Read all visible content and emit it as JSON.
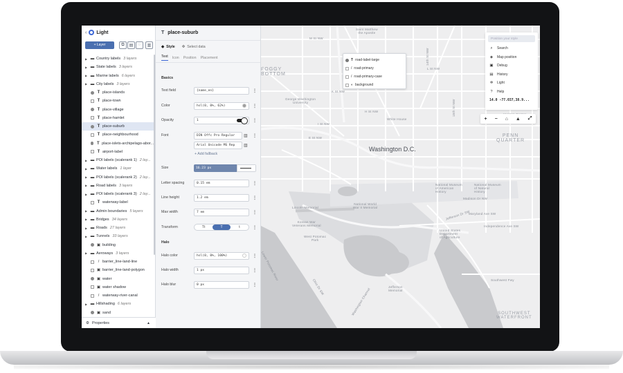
{
  "app": {
    "back_glyph": "‹",
    "title": "Light"
  },
  "toolbar": {
    "add_layer_label": "+ Layer",
    "buttons": [
      "copy-icon",
      "layers-icon",
      "visibility-icon",
      "trash-icon"
    ]
  },
  "layers": [
    {
      "type": "group",
      "name": "Country labels",
      "count": "3 layers"
    },
    {
      "type": "group",
      "name": "State labels",
      "count": "3 layers"
    },
    {
      "type": "group",
      "name": "Marine labels",
      "count": "6 layers"
    },
    {
      "type": "group",
      "name": "City labels",
      "count": "3 layers"
    },
    {
      "type": "symbol",
      "name": "place-islands",
      "count": ""
    },
    {
      "type": "symbol",
      "name": "place-town",
      "count": ""
    },
    {
      "type": "symbol",
      "name": "place-village",
      "count": ""
    },
    {
      "type": "symbol",
      "name": "place-hamlet",
      "count": ""
    },
    {
      "type": "symbol",
      "name": "place-suburb",
      "count": "",
      "selected": true
    },
    {
      "type": "symbol",
      "name": "place-neighbourhood",
      "count": ""
    },
    {
      "type": "symbol",
      "name": "place-islets-archipelago-abor...",
      "count": ""
    },
    {
      "type": "symbol",
      "name": "airport-label",
      "count": ""
    },
    {
      "type": "group",
      "name": "POI labels (scalerank 1)",
      "count": "2 lay..."
    },
    {
      "type": "group",
      "name": "Water labels",
      "count": "1 layer"
    },
    {
      "type": "group",
      "name": "POI labels (scalerank 2)",
      "count": "2 lay..."
    },
    {
      "type": "group",
      "name": "Road labels",
      "count": "3 layers"
    },
    {
      "type": "group",
      "name": "POI labels (scalerank 3)",
      "count": "2 lay..."
    },
    {
      "type": "symbol",
      "name": "waterway-label",
      "count": ""
    },
    {
      "type": "group",
      "name": "Admin boundaries",
      "count": "5 layers"
    },
    {
      "type": "group",
      "name": "Bridges",
      "count": "34 layers"
    },
    {
      "type": "group",
      "name": "Roads",
      "count": "27 layers"
    },
    {
      "type": "group",
      "name": "Tunnels",
      "count": "33 layers"
    },
    {
      "type": "fill",
      "name": "building",
      "count": ""
    },
    {
      "type": "group",
      "name": "Aeroways",
      "count": "3 layers"
    },
    {
      "type": "line",
      "name": "barrier_line-land-line",
      "count": ""
    },
    {
      "type": "fill",
      "name": "barrier_line-land-polygon",
      "count": ""
    },
    {
      "type": "fill",
      "name": "water",
      "count": ""
    },
    {
      "type": "fill",
      "name": "water shadow",
      "count": ""
    },
    {
      "type": "line",
      "name": "waterway-river-canal",
      "count": ""
    },
    {
      "type": "group",
      "name": "Hillshading",
      "count": "6 layers"
    },
    {
      "type": "fill",
      "name": "sand",
      "count": ""
    }
  ],
  "bottom": {
    "label": "Properties",
    "caret": "▲"
  },
  "editor": {
    "layer_icon": "T",
    "layer_name": "place-suburb",
    "tabs": [
      "Style",
      "Select data"
    ],
    "subtabs": [
      "Text",
      "Icon",
      "Position",
      "Placement"
    ],
    "sections": {
      "basics": "Basics",
      "halo": "Halo"
    },
    "fields": {
      "text_field": {
        "label": "Text field",
        "value": "{name_en}"
      },
      "color": {
        "label": "Color",
        "value": "hsl(0, 0%, 62%)"
      },
      "opacity": {
        "label": "Opacity",
        "value": "1"
      },
      "font": {
        "label": "Font",
        "values": [
          "DIN Offc Pro Regular",
          "Arial Unicode MS Rep"
        ],
        "add": "+ Add fallback"
      },
      "size": {
        "label": "Size",
        "value": "16.23 px"
      },
      "letter_spacing": {
        "label": "Letter spacing",
        "value": "0.15 em"
      },
      "line_height": {
        "label": "Line height",
        "value": "1.2 em"
      },
      "max_width": {
        "label": "Max width",
        "value": "7 em"
      },
      "transform": {
        "label": "Transform",
        "options": [
          "Tt",
          "T",
          "t"
        ],
        "selected": 1
      },
      "halo_color": {
        "label": "Halo color",
        "value": "hsl(0, 0%, 100%)"
      },
      "halo_width": {
        "label": "Halo width",
        "value": "1 px"
      },
      "halo_blur": {
        "label": "Halo blur",
        "value": "0 px"
      }
    }
  },
  "map": {
    "popup": [
      {
        "icon": "T",
        "name": "road-label-large"
      },
      {
        "icon": "/",
        "name": "road-primary"
      },
      {
        "icon": "/",
        "name": "road-primary-case"
      },
      {
        "icon": "◐",
        "name": "background"
      }
    ],
    "panel": {
      "search_placeholder": "Position your style",
      "items": [
        {
          "icon": "search-icon",
          "glyph": "⌕",
          "label": "Search"
        },
        {
          "icon": "map-position-icon",
          "glyph": "◈",
          "label": "Map position"
        },
        {
          "icon": "debug-icon",
          "glyph": "▣",
          "label": "Debug"
        },
        {
          "icon": "history-icon",
          "glyph": "▤",
          "label": "History"
        },
        {
          "icon": "light-icon",
          "glyph": "✲",
          "label": "Light"
        },
        {
          "icon": "help-icon",
          "glyph": "?",
          "label": "Help"
        }
      ],
      "coords": "14.0  -77.037,38.9..."
    },
    "controls": [
      "+",
      "−",
      "⌂",
      "▲",
      "⤢"
    ],
    "labels": {
      "city": "Washington D.C.",
      "quarter": "PENN\nQUARTER",
      "waterfront": "SOUTHWEST\nWATERFRONT",
      "streets": [
        "M St NW",
        "Saint Matthew\nthe Apostle",
        "L St NW",
        "K St NW",
        "I St NW",
        "H St NW",
        "F St NW",
        "E St NW",
        "George Washington\nUniversity",
        "White House",
        "FOGGY\nBOTTOM",
        "Lincoln Memorial",
        "National World\nWar II Memorial",
        "Korean War\nVeterans Memorial",
        "West Potomac\nPark",
        "Jefferson\nMemorial",
        "Independence Ave SW",
        "Southwest Fwy",
        "Maryland Ave SW",
        "United States\nDepartment\nof Agriculture",
        "National Museum\nof American\nHistory",
        "National Museum\nof Natural\nHistory",
        "Madison Dr NW",
        "Jefferson Dr SW",
        "Ohio Dr SW",
        "Lower Potomac River",
        "Washington Channel",
        "Vermont Ave NW",
        "15th St NW",
        "14th St NW",
        "Verizon Center",
        "Smithsonian"
      ]
    }
  }
}
